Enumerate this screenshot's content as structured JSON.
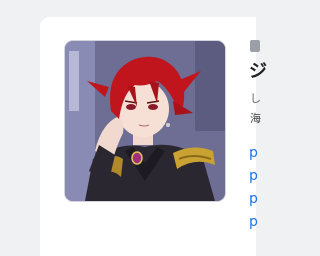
{
  "preview": {
    "title": "ジ",
    "subtitle": "し",
    "description": "海",
    "links": [
      "p",
      "p",
      "p",
      "p"
    ]
  },
  "thumbnail": {
    "alt_icon": "character-portrait-image",
    "colors": {
      "hair": "#c0151c",
      "jacket": "#2a2730",
      "gold_trim": "#c9a233",
      "gem": "#a0307a",
      "background": "#7d7fa0"
    }
  },
  "badge_icon": "badge-icon"
}
